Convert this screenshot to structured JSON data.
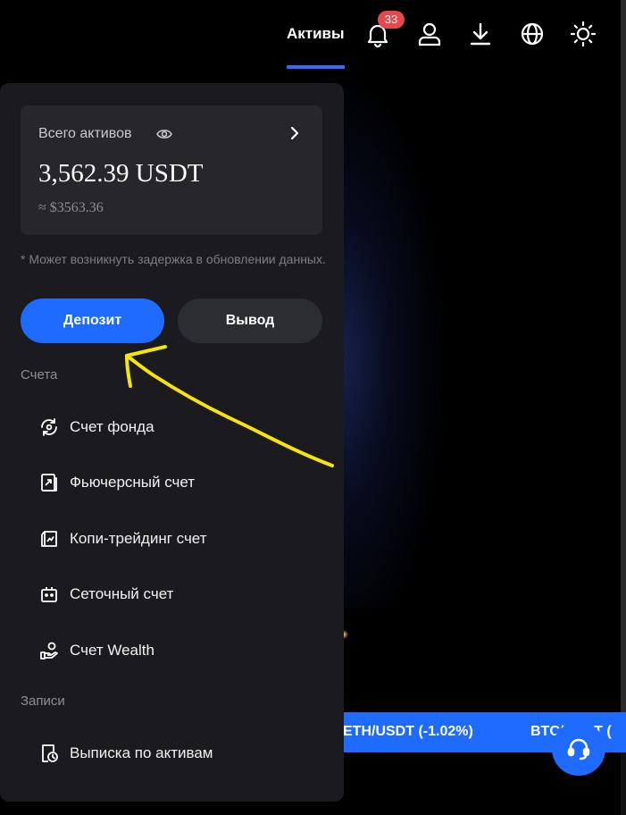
{
  "header": {
    "active_tab": "Активы",
    "notification_count": "33",
    "icons": [
      "bell-icon",
      "user-icon",
      "download-icon",
      "globe-icon",
      "sun-icon"
    ]
  },
  "panel": {
    "total_label": "Всего активов",
    "total_amount": "3,562.39 USDT",
    "total_approx": "≈ $3563.36",
    "delay_note": "* Может возникнуть задержка в обновлении данных.",
    "deposit_button": "Депозит",
    "withdraw_button": "Вывод",
    "accounts_section": "Счета",
    "accounts": [
      {
        "label": "Счет фонда",
        "icon": "fund-icon"
      },
      {
        "label": "Фьючерсный счет",
        "icon": "futures-icon"
      },
      {
        "label": "Копи-трейдинг счет",
        "icon": "copy-trading-icon"
      },
      {
        "label": "Сеточный счет",
        "icon": "grid-bot-icon"
      },
      {
        "label": "Счет Wealth",
        "icon": "wealth-icon"
      }
    ],
    "records_section": "Записи",
    "records": [
      {
        "label": "Выписка по активам",
        "icon": "statement-icon"
      }
    ]
  },
  "ticker": {
    "items": [
      "ETH/USDT (-1.02%)",
      "BTC/USDT ("
    ]
  },
  "colors": {
    "accent": "#1f6bff",
    "badge": "#e5484d",
    "panel": "#1b1b1f",
    "annotation_arrow": "#f5e50a"
  }
}
